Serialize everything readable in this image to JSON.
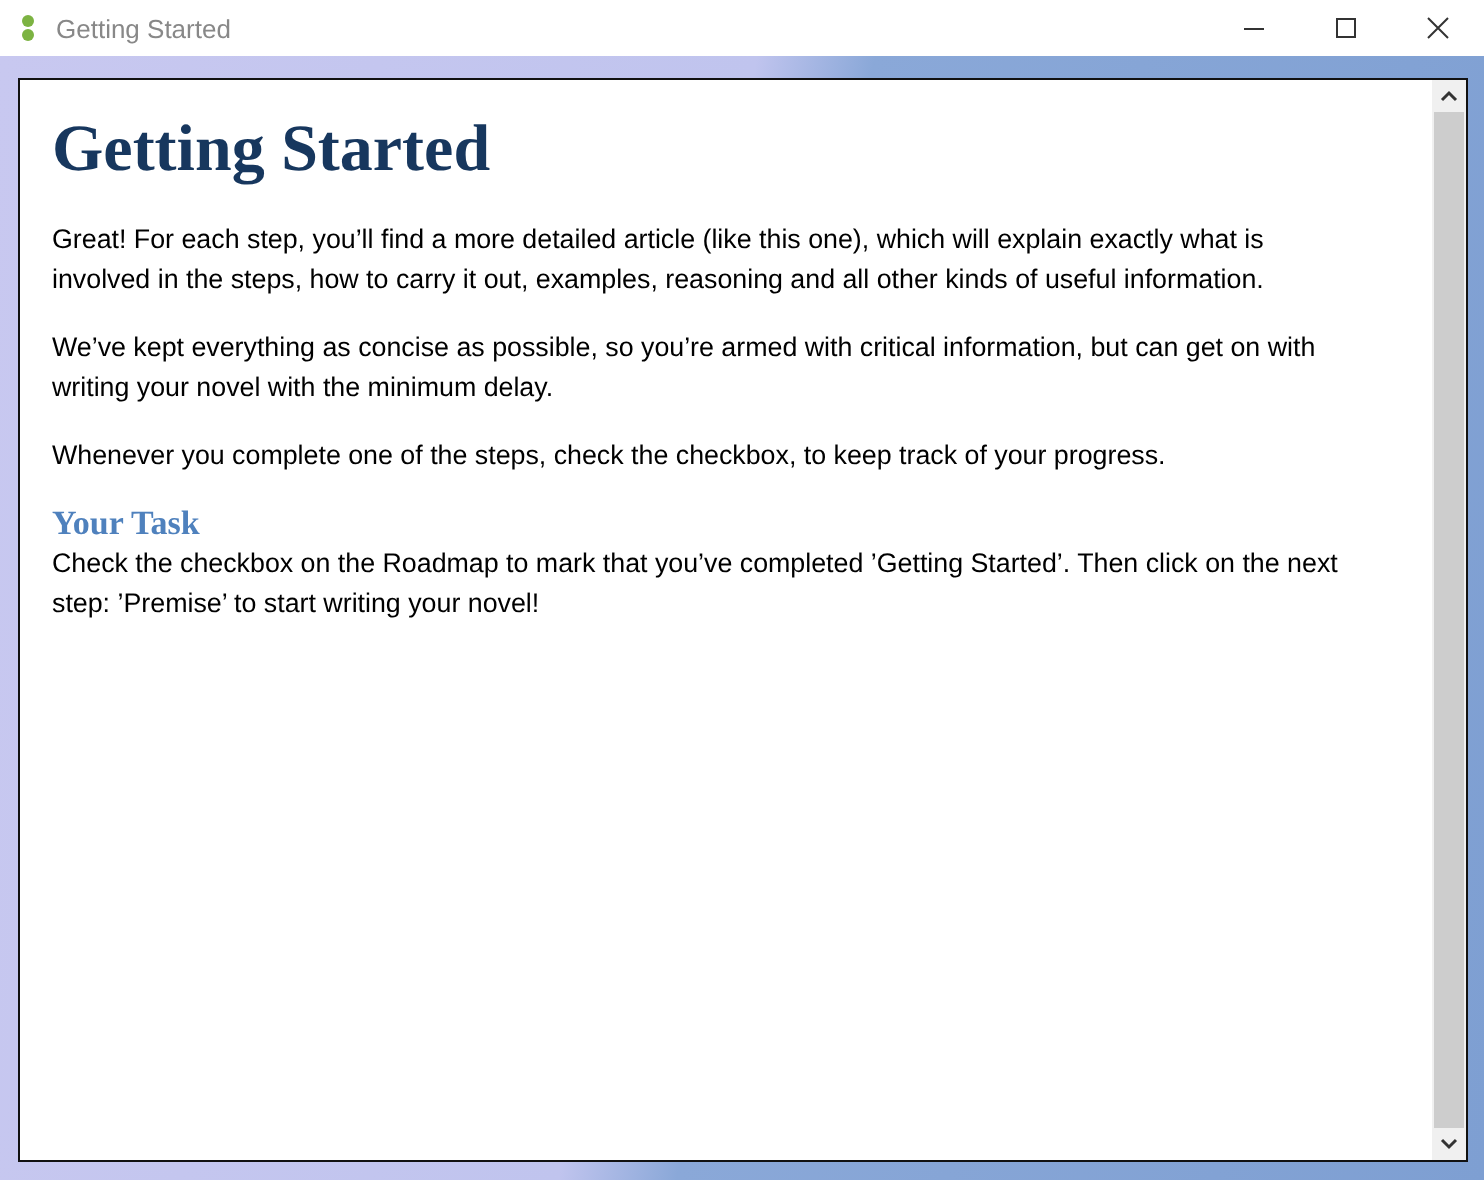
{
  "window": {
    "title": "Getting Started"
  },
  "article": {
    "heading": "Getting Started",
    "paragraphs": [
      "Great! For each step, you’ll find a more detailed article (like this one), which will explain exactly what is involved in the steps, how to carry it out, examples, reasoning and all other kinds of useful information.",
      "We’ve kept everything as concise as possible, so you’re armed with critical information, but can get on with writing your novel with the minimum delay.",
      "Whenever you complete one of the steps, check the checkbox, to keep track of your progress."
    ],
    "subheading": "Your Task",
    "task": "Check the checkbox on the Roadmap to mark that you’ve completed ’Getting Started’. Then click on the next step: ’Premise’ to start writing your novel!"
  }
}
